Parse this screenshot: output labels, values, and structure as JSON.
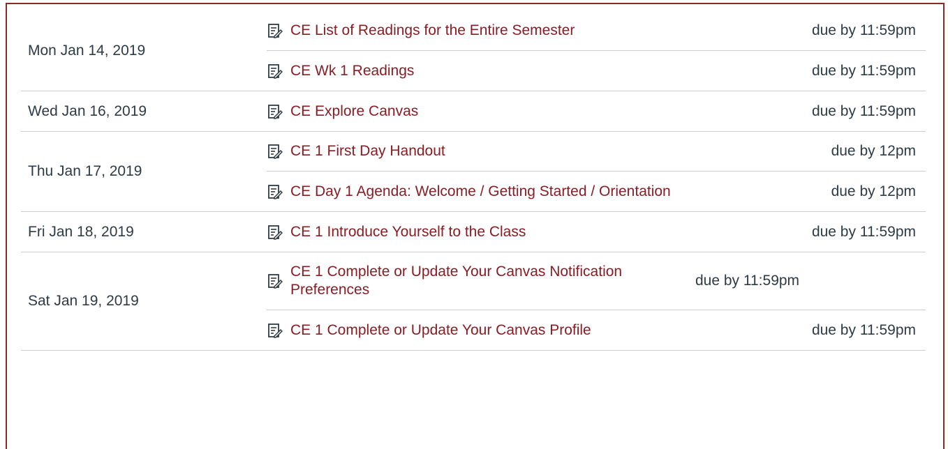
{
  "syllabus": {
    "days": [
      {
        "date": "Mon Jan 14, 2019",
        "items": [
          {
            "title": "CE List of Readings for the Entire Semester",
            "due": "due by 11:59pm",
            "icon": "assignment-icon"
          },
          {
            "title": "CE Wk 1 Readings",
            "due": "due by 11:59pm",
            "icon": "assignment-icon"
          }
        ]
      },
      {
        "date": "Wed Jan 16, 2019",
        "items": [
          {
            "title": "CE Explore Canvas",
            "due": "due by 11:59pm",
            "icon": "assignment-icon"
          }
        ]
      },
      {
        "date": "Thu Jan 17, 2019",
        "items": [
          {
            "title": "CE 1 First Day Handout",
            "due": "due by 12pm",
            "icon": "assignment-icon"
          },
          {
            "title": "CE Day 1 Agenda: Welcome / Getting Started / Orientation",
            "due": "due by 12pm",
            "icon": "assignment-icon"
          }
        ]
      },
      {
        "date": "Fri Jan 18, 2019",
        "items": [
          {
            "title": "CE 1 Introduce Yourself to the Class",
            "due": "due by 11:59pm",
            "icon": "assignment-icon"
          }
        ]
      },
      {
        "date": "Sat Jan 19, 2019",
        "items": [
          {
            "title": "CE 1 Complete or Update Your Canvas Notification Preferences",
            "due": "due by 11:59pm",
            "icon": "assignment-icon"
          },
          {
            "title": "CE 1 Complete or Update Your Canvas Profile",
            "due": "due by 11:59pm",
            "icon": "assignment-icon"
          }
        ]
      }
    ]
  },
  "colors": {
    "link": "#8a1d24",
    "text": "#2d3b45",
    "border": "#8a2b2b",
    "divider": "#c7cdd1"
  }
}
